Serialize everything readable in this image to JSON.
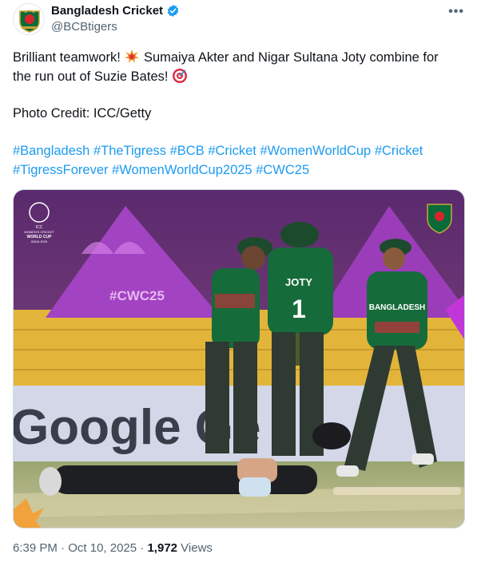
{
  "account": {
    "display_name": "Bangladesh Cricket",
    "handle": "@BCBtigers",
    "verified": true,
    "more_label": "•••"
  },
  "tweet": {
    "line1_a": "Brilliant teamwork! ",
    "line1_b": " Sumaiya Akter and Nigar Sultana Joty combine for",
    "line2": "the run out of Suzie Bates! ",
    "credit": "Photo Credit: ICC/Getty",
    "hashtags": [
      "#Bangladesh",
      "#TheTigress",
      "#BCB",
      "#Cricket",
      "#WomenWorldCup",
      "#Cricket",
      "#TigressForever",
      "#WomenWorldCup2025",
      "#CWC25"
    ]
  },
  "media": {
    "player_name_jersey": "JOTY",
    "player_number": "1",
    "jersey_text": "BANGLADESH",
    "banner_text": "Google Ge",
    "tent_text": "#CWC25",
    "badge_lines": [
      "ICC",
      "WOMEN'S CRICKET",
      "WORLD CUP",
      "INDIA 2025"
    ]
  },
  "meta": {
    "time": "6:39 PM",
    "separator": " · ",
    "date": "Oct 10, 2025",
    "views_count": "1,972",
    "views_label": " Views"
  },
  "colors": {
    "link": "#1d9bf0",
    "verified": "#1d9bf0",
    "secondary_text": "#536471"
  },
  "icons": [
    "bcb-logo-avatar",
    "verified-badge-icon",
    "more-icon",
    "collision-emoji",
    "target-emoji"
  ]
}
